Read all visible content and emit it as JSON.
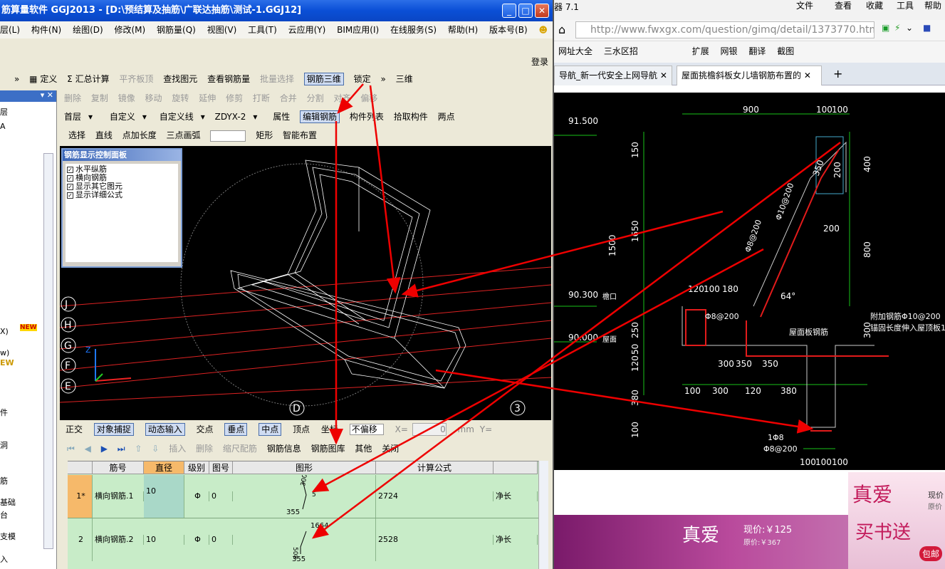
{
  "app": {
    "title": "筋算量软件 GGJ2013 - [D:\\预结算及抽筋\\广联达抽筋\\测试-1.GGJ12]",
    "menu": [
      "层(L)",
      "构件(N)",
      "绘图(D)",
      "修改(M)",
      "钢筋量(Q)",
      "视图(V)",
      "工具(T)",
      "云应用(Y)",
      "BIM应用(I)",
      "在线服务(S)",
      "帮助(H)",
      "版本号(B)"
    ],
    "login": "登录",
    "toolbar1": {
      "define": "定义",
      "sum": "汇总计算",
      "flush": "平齐板顶",
      "find": "查找图元",
      "view_rebar": "查看钢筋量",
      "batch": "批量选择",
      "rebar3d": "钢筋三维",
      "lock": "锁定",
      "view3d": "三维"
    },
    "toolbar2": {
      "delete": "删除",
      "copy": "复制",
      "mirror": "镜像",
      "move": "移动",
      "rotate": "旋转",
      "extend": "延伸",
      "trim": "修剪",
      "break": "打断",
      "merge": "合并",
      "split": "分割",
      "align": "对齐",
      "offset": "偏移"
    },
    "toolbar3": {
      "floor": "首层",
      "custom": "自定义",
      "custom_line": "自定义线",
      "element": "ZDYX-2",
      "props": "属性",
      "edit_rebar": "编辑钢筋",
      "list": "构件列表",
      "pick": "拾取构件",
      "two_point": "两点"
    },
    "toolbar4": {
      "select": "选择",
      "line": "直线",
      "point_len": "点加长度",
      "arc": "三点画弧",
      "rect": "矩形",
      "smart": "智能布置"
    },
    "sidebar": {
      "items": [
        "层",
        "A",
        "X)",
        "NEW",
        "w)",
        "EW",
        "件",
        "洞",
        "筋",
        "基础",
        "台",
        "支模",
        "入"
      ]
    },
    "control_panel": {
      "title": "钢筋显示控制面板",
      "options": [
        "水平纵筋",
        "横向钢筋",
        "显示其它图元",
        "显示详细公式"
      ]
    },
    "axis_labels": [
      "J",
      "H",
      "G",
      "F",
      "E",
      "D",
      "3"
    ],
    "snapbar": {
      "ortho": "正交",
      "snap": "对象捕捉",
      "dyn": "动态输入",
      "intersect": "交点",
      "perp": "垂点",
      "mid": "中点",
      "vertex": "顶点",
      "coord": "坐标",
      "no_offset": "不偏移",
      "x": "X=",
      "x_val": "0",
      "mm": "mm",
      "y": "Y="
    },
    "navbar": {
      "insert": "插入",
      "delete": "删除",
      "scale": "缩尺配筋",
      "info": "钢筋信息",
      "lib": "钢筋图库",
      "other": "其他",
      "close": "关闭"
    },
    "grid": {
      "headers": [
        "筋号",
        "直径(mm)",
        "级别",
        "图号",
        "图形",
        "计算公式"
      ],
      "rows": [
        {
          "no": "1*",
          "name": "横向钢筋.1",
          "dia": "10",
          "grade": "Φ",
          "fig": "0",
          "shape_a": "300",
          "shape_b": "355",
          "shape_c": "5",
          "formula": "2724",
          "note": "净长"
        },
        {
          "no": "2",
          "name": "横向钢筋.2",
          "dia": "10",
          "grade": "Φ",
          "fig": "0",
          "shape_a": "1664",
          "shape_b": "355",
          "shape_c": "508",
          "formula": "2528",
          "note": "净长"
        }
      ]
    }
  },
  "browser": {
    "top_left": "器 7.1",
    "menu": [
      "文件",
      "查看",
      "收藏",
      "工具",
      "帮助"
    ],
    "url": "http://www.fwxgx.com/question/gimq/detail/1373770.html",
    "fav": [
      "网址大全",
      "三水区招",
      "扩展",
      "网银",
      "翻译",
      "截图"
    ],
    "tabs": [
      "导航_新一代安全上网导航",
      "屋面挑檐斜板女儿墙钢筋布置的"
    ],
    "cad": {
      "dims_top": [
        "900",
        "100",
        "100"
      ],
      "elev": [
        "91.500",
        "90.300",
        "90.000"
      ],
      "elev_tags": [
        "檐口",
        "屋面"
      ],
      "left_dims": [
        "150",
        "1650",
        "250",
        "120",
        "50",
        "380",
        "100"
      ],
      "total_left": "1500",
      "right_dims": [
        "400",
        "800",
        "300"
      ],
      "labels": [
        "350",
        "200",
        "200",
        "120",
        "100",
        "180",
        "64°",
        "300",
        "350",
        "350",
        "100",
        "300",
        "120",
        "380",
        "100",
        "100",
        "100"
      ],
      "rebar_notes": [
        "Φ10@200",
        "Φ8@200",
        "Φ8@200",
        "1Φ8",
        "Φ8@200"
      ],
      "right_notes": [
        "附加钢筋Φ10@200",
        "锚固长度伸入屋顶板140",
        "屋面板钢筋"
      ]
    },
    "ads": {
      "brand": "真爱",
      "price_now": "现价:￥125",
      "price_orig": "原价:￥367",
      "brand2": "真爱",
      "now2": "现价",
      "orig2": "原价",
      "slogan": "买书送",
      "pack": "包邮"
    }
  }
}
